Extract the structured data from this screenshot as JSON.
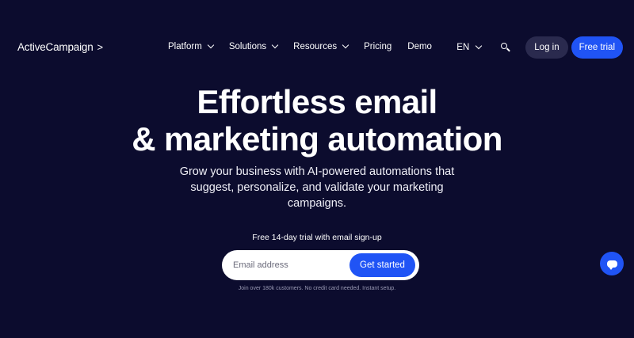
{
  "header": {
    "logo_text": "ActiveCampaign",
    "logo_mark": ">",
    "nav": [
      {
        "label": "Platform",
        "has_menu": true
      },
      {
        "label": "Solutions",
        "has_menu": true
      },
      {
        "label": "Resources",
        "has_menu": true
      },
      {
        "label": "Pricing",
        "has_menu": false
      },
      {
        "label": "Demo",
        "has_menu": false
      }
    ],
    "language": "EN",
    "search_icon": "search-icon",
    "login_label": "Log in",
    "trial_label": "Free trial"
  },
  "hero": {
    "title_line1": "Effortless email",
    "title_line2": "& marketing automation",
    "subtitle": "Grow your business with AI-powered automations that suggest, personalize, and validate your marketing campaigns.",
    "trial_note": "Free 14-day trial with email sign-up",
    "email_placeholder": "Email address",
    "cta_label": "Get started",
    "fine_print": "Join over 180k customers. No credit card needed. Instant setup."
  },
  "chat": {
    "icon": "chat-icon"
  },
  "colors": {
    "background": "#0c0c2e",
    "accent": "#2054f5",
    "login_bg": "#2a2a4e"
  }
}
